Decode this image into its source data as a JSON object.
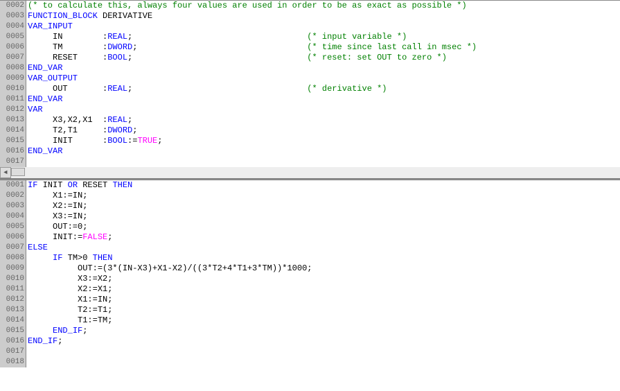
{
  "top_pane": {
    "lines": [
      {
        "num": "0002",
        "segments": [
          {
            "t": "(* to calculate this, always four values are used in order to be as exact as possible *)",
            "c": "comment"
          }
        ]
      },
      {
        "num": "0003",
        "segments": [
          {
            "t": "FUNCTION_BLOCK",
            "c": "kw"
          },
          {
            "t": " DERIVATIVE",
            "c": ""
          }
        ]
      },
      {
        "num": "0004",
        "segments": [
          {
            "t": "VAR_INPUT",
            "c": "kw"
          }
        ]
      },
      {
        "num": "0005",
        "segments": [
          {
            "t": "     IN        :",
            "c": ""
          },
          {
            "t": "REAL",
            "c": "type"
          },
          {
            "t": ";",
            "c": ""
          },
          {
            "t": "                                   ",
            "c": ""
          },
          {
            "t": "(* input variable *)",
            "c": "comment"
          }
        ]
      },
      {
        "num": "0006",
        "segments": [
          {
            "t": "     TM        :",
            "c": ""
          },
          {
            "t": "DWORD",
            "c": "type"
          },
          {
            "t": ";",
            "c": ""
          },
          {
            "t": "                                  ",
            "c": ""
          },
          {
            "t": "(* time since last call in msec *)",
            "c": "comment"
          }
        ]
      },
      {
        "num": "0007",
        "segments": [
          {
            "t": "     RESET     :",
            "c": ""
          },
          {
            "t": "BOOL",
            "c": "type"
          },
          {
            "t": ";",
            "c": ""
          },
          {
            "t": "                                   ",
            "c": ""
          },
          {
            "t": "(* reset: set OUT to zero *)",
            "c": "comment"
          }
        ]
      },
      {
        "num": "0008",
        "segments": [
          {
            "t": "END_VAR",
            "c": "kw"
          }
        ]
      },
      {
        "num": "0009",
        "segments": [
          {
            "t": "VAR_OUTPUT",
            "c": "kw"
          }
        ]
      },
      {
        "num": "0010",
        "segments": [
          {
            "t": "     OUT       :",
            "c": ""
          },
          {
            "t": "REAL",
            "c": "type"
          },
          {
            "t": ";",
            "c": ""
          },
          {
            "t": "                                   ",
            "c": ""
          },
          {
            "t": "(* derivative *)",
            "c": "comment"
          }
        ]
      },
      {
        "num": "0011",
        "segments": [
          {
            "t": "END_VAR",
            "c": "kw"
          }
        ]
      },
      {
        "num": "0012",
        "segments": [
          {
            "t": "VAR",
            "c": "kw"
          }
        ]
      },
      {
        "num": "0013",
        "segments": [
          {
            "t": "     X3,X2,X1  :",
            "c": ""
          },
          {
            "t": "REAL",
            "c": "type"
          },
          {
            "t": ";",
            "c": ""
          }
        ]
      },
      {
        "num": "0014",
        "segments": [
          {
            "t": "     T2,T1     :",
            "c": ""
          },
          {
            "t": "DWORD",
            "c": "type"
          },
          {
            "t": ";",
            "c": ""
          }
        ]
      },
      {
        "num": "0015",
        "segments": [
          {
            "t": "     INIT      :",
            "c": ""
          },
          {
            "t": "BOOL",
            "c": "type"
          },
          {
            "t": ":=",
            "c": ""
          },
          {
            "t": "TRUE",
            "c": "const"
          },
          {
            "t": ";",
            "c": ""
          }
        ]
      },
      {
        "num": "0016",
        "segments": [
          {
            "t": "END_VAR",
            "c": "kw"
          }
        ]
      },
      {
        "num": "0017",
        "segments": []
      }
    ]
  },
  "bottom_pane": {
    "lines": [
      {
        "num": "0001",
        "segments": [
          {
            "t": "IF",
            "c": "kw"
          },
          {
            "t": " INIT ",
            "c": ""
          },
          {
            "t": "OR",
            "c": "kw"
          },
          {
            "t": " RESET ",
            "c": ""
          },
          {
            "t": "THEN",
            "c": "kw"
          }
        ]
      },
      {
        "num": "0002",
        "segments": [
          {
            "t": "     X1:=IN;",
            "c": ""
          }
        ]
      },
      {
        "num": "0003",
        "segments": [
          {
            "t": "     X2:=IN;",
            "c": ""
          }
        ]
      },
      {
        "num": "0004",
        "segments": [
          {
            "t": "     X3:=IN;",
            "c": ""
          }
        ]
      },
      {
        "num": "0005",
        "segments": [
          {
            "t": "     OUT:=0;",
            "c": ""
          }
        ]
      },
      {
        "num": "0006",
        "segments": [
          {
            "t": "     INIT:=",
            "c": ""
          },
          {
            "t": "FALSE",
            "c": "const"
          },
          {
            "t": ";",
            "c": ""
          }
        ]
      },
      {
        "num": "0007",
        "segments": [
          {
            "t": "ELSE",
            "c": "kw"
          }
        ]
      },
      {
        "num": "0008",
        "segments": [
          {
            "t": "     ",
            "c": ""
          },
          {
            "t": "IF",
            "c": "kw"
          },
          {
            "t": " TM>0 ",
            "c": ""
          },
          {
            "t": "THEN",
            "c": "kw"
          }
        ]
      },
      {
        "num": "0009",
        "segments": [
          {
            "t": "          OUT:=(3*(IN-X3)+X1-X2)/((3*T2+4*T1+3*TM))*1000;",
            "c": ""
          }
        ]
      },
      {
        "num": "0010",
        "segments": [
          {
            "t": "          X3:=X2;",
            "c": ""
          }
        ]
      },
      {
        "num": "0011",
        "segments": [
          {
            "t": "          X2:=X1;",
            "c": ""
          }
        ]
      },
      {
        "num": "0012",
        "segments": [
          {
            "t": "          X1:=IN;",
            "c": ""
          }
        ]
      },
      {
        "num": "0013",
        "segments": [
          {
            "t": "          T2:=T1;",
            "c": ""
          }
        ]
      },
      {
        "num": "0014",
        "segments": [
          {
            "t": "          T1:=TM;",
            "c": ""
          }
        ]
      },
      {
        "num": "0015",
        "segments": [
          {
            "t": "     ",
            "c": ""
          },
          {
            "t": "END_IF",
            "c": "kw"
          },
          {
            "t": ";",
            "c": ""
          }
        ]
      },
      {
        "num": "0016",
        "segments": [
          {
            "t": "END_IF",
            "c": "kw"
          },
          {
            "t": ";",
            "c": ""
          }
        ]
      },
      {
        "num": "0017",
        "segments": []
      },
      {
        "num": "0018",
        "segments": []
      }
    ]
  },
  "scrollbar": {
    "left_arrow": "◄"
  }
}
